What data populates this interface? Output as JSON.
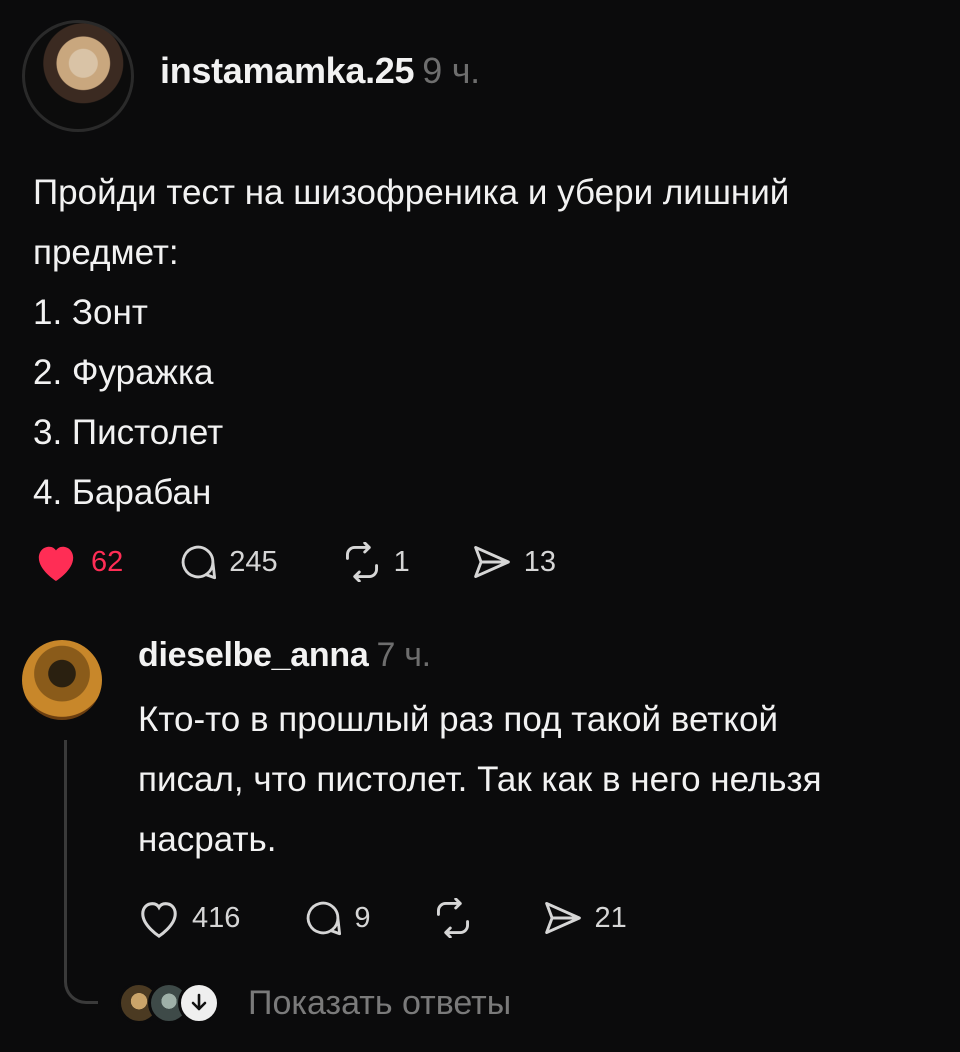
{
  "post": {
    "username": "instamamka.25",
    "time": "9 ч.",
    "lines": [
      "Пройди тест на шизофреника и убери лишний",
      "предмет:",
      "1. Зонт",
      "2. Фуражка",
      "3. Пистолет",
      "4. Барабан"
    ],
    "likes": "62",
    "comments": "245",
    "reposts": "1",
    "shares": "13",
    "like_color": "#ff2d55"
  },
  "comment": {
    "username": "dieselbe_anna",
    "time": "7 ч.",
    "lines": [
      "Кто-то в прошлый раз под такой веткой",
      "писал, что пистолет. Так как в него нельзя",
      "насрать."
    ],
    "likes": "416",
    "comments": "9",
    "shares": "21"
  },
  "replies": {
    "label": "Показать ответы"
  },
  "icons": {
    "like": "heart-icon",
    "comment": "speech-bubble-icon",
    "repost": "repost-icon",
    "share": "send-icon",
    "show-replies": "arrow-down-icon"
  }
}
